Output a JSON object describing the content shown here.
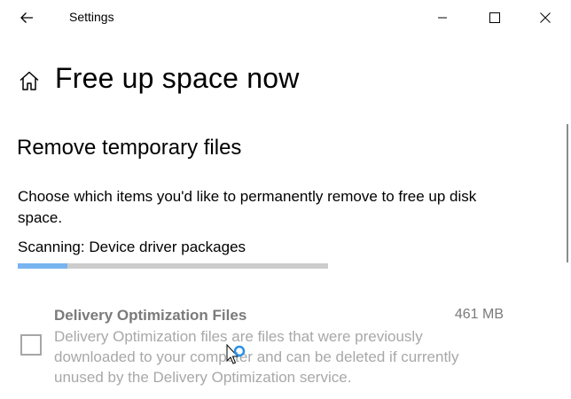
{
  "window": {
    "title": "Settings",
    "back_icon": "arrow-left-icon",
    "minimize_icon": "minimize-icon",
    "maximize_icon": "maximize-icon",
    "close_icon": "close-icon"
  },
  "page": {
    "icon": "home-icon",
    "title": "Free up space now"
  },
  "section": {
    "title": "Remove temporary files",
    "description": "Choose which items you'd like to permanently remove to free up disk space."
  },
  "scan": {
    "status": "Scanning: Device driver packages",
    "progress": 0.16,
    "accent_color": "#78b4f0",
    "track_color": "#cccccc"
  },
  "items": [
    {
      "name": "Delivery Optimization Files",
      "size": "461 MB",
      "description": "Delivery Optimization files are files that were previously downloaded to your computer and can be deleted if currently unused by the Delivery Optimization service.",
      "checked": false
    }
  ]
}
